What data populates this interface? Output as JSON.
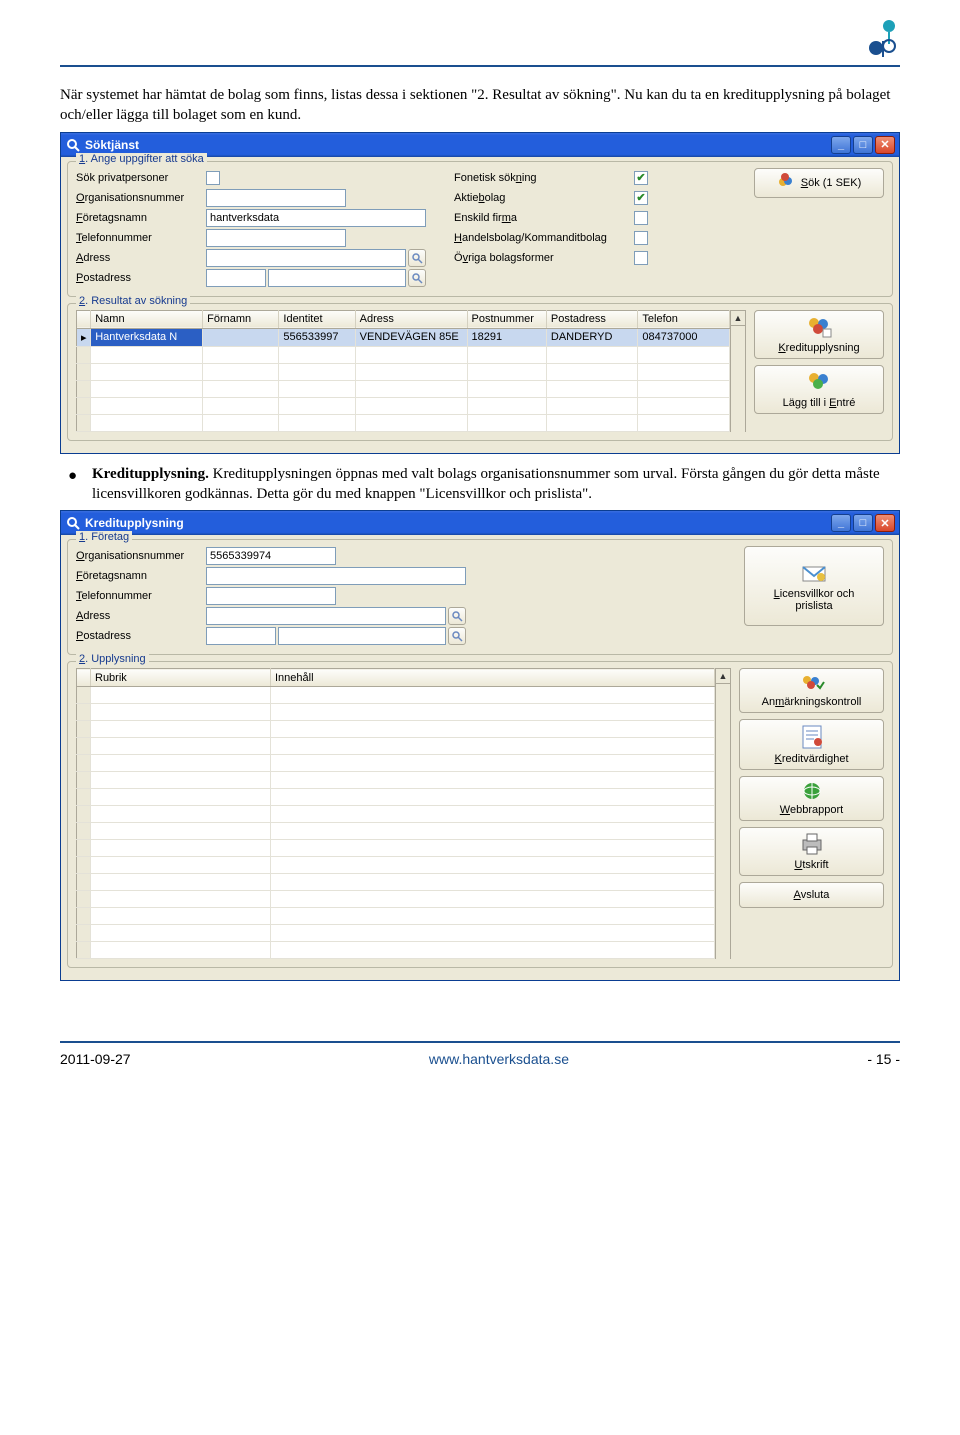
{
  "page": {
    "intro": "När systemet har hämtat de bolag som finns, listas dessa i sektionen \"2. Resultat av sökning\". Nu kan du ta en kreditupplysning på bolaget och/eller lägga till bolaget som en kund.",
    "bullet_title": "Kreditupplysning.",
    "bullet_rest": " Kreditupplysningen öppnas med valt bolags organisationsnummer som urval. Första gången du gör detta måste licensvillkoren godkännas. Detta gör du med knappen \"Licensvillkor och prislista\"."
  },
  "footer": {
    "date": "2011-09-27",
    "url": "www.hantverksdata.se",
    "page": "- 15 -"
  },
  "app1": {
    "title": "Söktjänst",
    "group1_title": "1. Ange uppgifter att söka",
    "labels": {
      "priv": "Sök privatpersoner",
      "orgnr": "Organisationsnummer",
      "foretag": "Företagsnamn",
      "tel": "Telefonnummer",
      "adress": "Adress",
      "post": "Postadress",
      "fonetisk": "Fonetisk sökning",
      "aktie": "Aktiebolag",
      "enskild": "Enskild firma",
      "handels": "Handelsbolag/Kommanditbolag",
      "ovriga": "Övriga bolagsformer"
    },
    "values": {
      "foretagsnamn": "hantverksdata"
    },
    "sok_btn": "Sök (1 SEK)",
    "group2_title": "2. Resultat av sökning",
    "columns": [
      "Namn",
      "Förnamn",
      "Identitet",
      "Adress",
      "Postnummer",
      "Postadress",
      "Telefon"
    ],
    "row": {
      "namn": "Hantverksdata N",
      "fornamn": "",
      "identitet": "556533997",
      "adress": "VENDEVÄGEN 85E",
      "postnr": "18291",
      "postadr": "DANDERYD",
      "tel": "084737000"
    },
    "btn_kredit": "Kreditupplysning",
    "btn_entre": "Lägg till i Entré"
  },
  "app2": {
    "title": "Kreditupplysning",
    "group1_title": "1. Företag",
    "labels": {
      "orgnr": "Organisationsnummer",
      "foretag": "Företagsnamn",
      "tel": "Telefonnummer",
      "adress": "Adress",
      "post": "Postadress"
    },
    "values": {
      "orgnr": "5565339974"
    },
    "btn_licens_l1": "Licensvillkor och",
    "btn_licens_l2": "prislista",
    "group2_title": "2. Upplysning",
    "columns": [
      "Rubrik",
      "Innehåll"
    ],
    "btn_anm": "Anmärkningskontroll",
    "btn_kv": "Kreditvärdighet",
    "btn_web": "Webbrapport",
    "btn_print": "Utskrift",
    "btn_close": "Avsluta"
  }
}
